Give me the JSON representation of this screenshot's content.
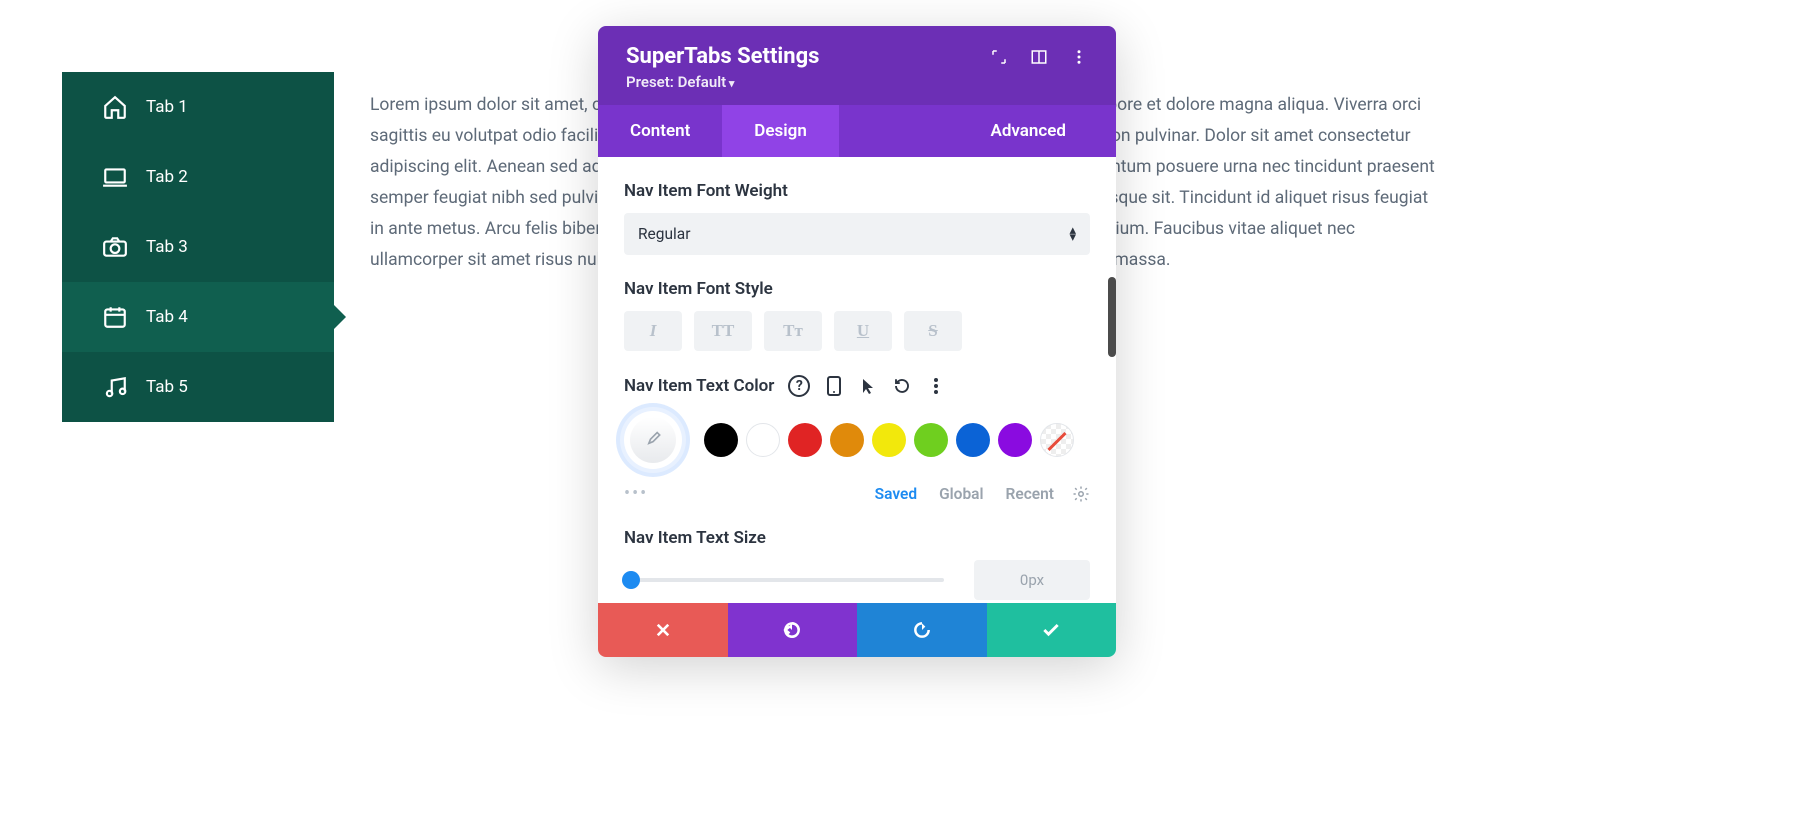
{
  "sidebar": {
    "items": [
      {
        "label": "Tab 1",
        "icon": "home"
      },
      {
        "label": "Tab 2",
        "icon": "laptop"
      },
      {
        "label": "Tab 3",
        "icon": "camera"
      },
      {
        "label": "Tab 4",
        "icon": "calendar",
        "active": true
      },
      {
        "label": "Tab 5",
        "icon": "music"
      }
    ]
  },
  "content": {
    "body_text": "Lorem ipsum dolor sit amet, consectetur adipiscing elit, sed do eiusmod tempor incididunt ut labore et dolore magna aliqua. Viverra orci sagittis eu volutpat odio facilisis mauris sit amet. Imperdiet proin fermentum leo vel orci porta non pulvinar. Dolor sit amet consectetur adipiscing elit. Aenean sed adipiscing diam donec adipiscing tristique risus nec feugiat in fermentum posuere urna nec tincidunt praesent semper feugiat nibh sed pulvinar proin gravida hendrerit lectus a. Enim nunc faucibus a pellentesque sit. Tincidunt id aliquet risus feugiat in ante metus. Arcu felis bibendum ut tristique et. Tortor at auctor urna nunc id velit ut tortor pretium. Faucibus vitae aliquet nec ullamcorper sit amet risus nullam eget felis eget nunc lobortis mattis aliquam faucibus purus in massa."
  },
  "panel": {
    "title": "SuperTabs Settings",
    "preset": "Preset: Default",
    "tabs": [
      {
        "label": "Content"
      },
      {
        "label": "Design",
        "active": true
      },
      {
        "label": "Advanced"
      }
    ],
    "nav_font_weight": {
      "label": "Nav Item Font Weight",
      "value": "Regular"
    },
    "nav_font_style": {
      "label": "Nav Item Font Style",
      "buttons": [
        "I",
        "TT",
        "Tᴛ",
        "U",
        "S"
      ]
    },
    "nav_text_color": {
      "label": "Nav Item Text Color",
      "swatches": [
        "#000000",
        "#ffffff",
        "#e02424",
        "#e08a0b",
        "#f2e80c",
        "#6fcf1f",
        "#0b63d6",
        "#8a0be0"
      ],
      "palette_tabs": [
        {
          "label": "Saved",
          "active": true
        },
        {
          "label": "Global"
        },
        {
          "label": "Recent"
        }
      ]
    },
    "nav_text_size": {
      "label": "Nav Item Text Size",
      "value": "0px"
    }
  }
}
